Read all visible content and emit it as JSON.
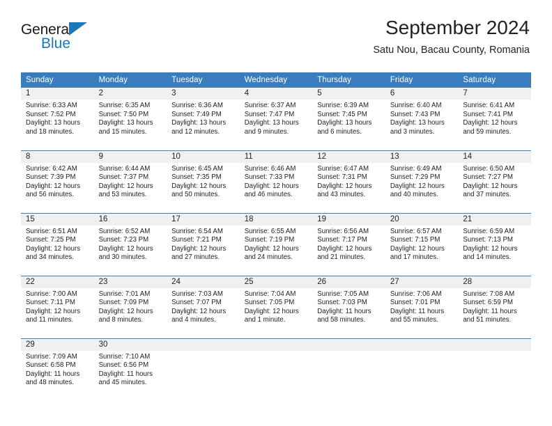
{
  "brand": {
    "name_top": "General",
    "name_bottom": "Blue",
    "triangle_color": "#1878be",
    "text_color": "#1a1a1a"
  },
  "header": {
    "title": "September 2024",
    "subtitle": "Satu Nou, Bacau County, Romania"
  },
  "theme": {
    "header_blue": "#3a7dbf",
    "daynum_band": "#f0f0f0",
    "text": "#222222",
    "separator_blue": "#3a7dbf"
  },
  "columns": [
    "Sunday",
    "Monday",
    "Tuesday",
    "Wednesday",
    "Thursday",
    "Friday",
    "Saturday"
  ],
  "weeks": [
    [
      {
        "day": "1",
        "sunrise": "Sunrise: 6:33 AM",
        "sunset": "Sunset: 7:52 PM",
        "daylight_1": "Daylight: 13 hours",
        "daylight_2": "and 18 minutes."
      },
      {
        "day": "2",
        "sunrise": "Sunrise: 6:35 AM",
        "sunset": "Sunset: 7:50 PM",
        "daylight_1": "Daylight: 13 hours",
        "daylight_2": "and 15 minutes."
      },
      {
        "day": "3",
        "sunrise": "Sunrise: 6:36 AM",
        "sunset": "Sunset: 7:49 PM",
        "daylight_1": "Daylight: 13 hours",
        "daylight_2": "and 12 minutes."
      },
      {
        "day": "4",
        "sunrise": "Sunrise: 6:37 AM",
        "sunset": "Sunset: 7:47 PM",
        "daylight_1": "Daylight: 13 hours",
        "daylight_2": "and 9 minutes."
      },
      {
        "day": "5",
        "sunrise": "Sunrise: 6:39 AM",
        "sunset": "Sunset: 7:45 PM",
        "daylight_1": "Daylight: 13 hours",
        "daylight_2": "and 6 minutes."
      },
      {
        "day": "6",
        "sunrise": "Sunrise: 6:40 AM",
        "sunset": "Sunset: 7:43 PM",
        "daylight_1": "Daylight: 13 hours",
        "daylight_2": "and 3 minutes."
      },
      {
        "day": "7",
        "sunrise": "Sunrise: 6:41 AM",
        "sunset": "Sunset: 7:41 PM",
        "daylight_1": "Daylight: 12 hours",
        "daylight_2": "and 59 minutes."
      }
    ],
    [
      {
        "day": "8",
        "sunrise": "Sunrise: 6:42 AM",
        "sunset": "Sunset: 7:39 PM",
        "daylight_1": "Daylight: 12 hours",
        "daylight_2": "and 56 minutes."
      },
      {
        "day": "9",
        "sunrise": "Sunrise: 6:44 AM",
        "sunset": "Sunset: 7:37 PM",
        "daylight_1": "Daylight: 12 hours",
        "daylight_2": "and 53 minutes."
      },
      {
        "day": "10",
        "sunrise": "Sunrise: 6:45 AM",
        "sunset": "Sunset: 7:35 PM",
        "daylight_1": "Daylight: 12 hours",
        "daylight_2": "and 50 minutes."
      },
      {
        "day": "11",
        "sunrise": "Sunrise: 6:46 AM",
        "sunset": "Sunset: 7:33 PM",
        "daylight_1": "Daylight: 12 hours",
        "daylight_2": "and 46 minutes."
      },
      {
        "day": "12",
        "sunrise": "Sunrise: 6:47 AM",
        "sunset": "Sunset: 7:31 PM",
        "daylight_1": "Daylight: 12 hours",
        "daylight_2": "and 43 minutes."
      },
      {
        "day": "13",
        "sunrise": "Sunrise: 6:49 AM",
        "sunset": "Sunset: 7:29 PM",
        "daylight_1": "Daylight: 12 hours",
        "daylight_2": "and 40 minutes."
      },
      {
        "day": "14",
        "sunrise": "Sunrise: 6:50 AM",
        "sunset": "Sunset: 7:27 PM",
        "daylight_1": "Daylight: 12 hours",
        "daylight_2": "and 37 minutes."
      }
    ],
    [
      {
        "day": "15",
        "sunrise": "Sunrise: 6:51 AM",
        "sunset": "Sunset: 7:25 PM",
        "daylight_1": "Daylight: 12 hours",
        "daylight_2": "and 34 minutes."
      },
      {
        "day": "16",
        "sunrise": "Sunrise: 6:52 AM",
        "sunset": "Sunset: 7:23 PM",
        "daylight_1": "Daylight: 12 hours",
        "daylight_2": "and 30 minutes."
      },
      {
        "day": "17",
        "sunrise": "Sunrise: 6:54 AM",
        "sunset": "Sunset: 7:21 PM",
        "daylight_1": "Daylight: 12 hours",
        "daylight_2": "and 27 minutes."
      },
      {
        "day": "18",
        "sunrise": "Sunrise: 6:55 AM",
        "sunset": "Sunset: 7:19 PM",
        "daylight_1": "Daylight: 12 hours",
        "daylight_2": "and 24 minutes."
      },
      {
        "day": "19",
        "sunrise": "Sunrise: 6:56 AM",
        "sunset": "Sunset: 7:17 PM",
        "daylight_1": "Daylight: 12 hours",
        "daylight_2": "and 21 minutes."
      },
      {
        "day": "20",
        "sunrise": "Sunrise: 6:57 AM",
        "sunset": "Sunset: 7:15 PM",
        "daylight_1": "Daylight: 12 hours",
        "daylight_2": "and 17 minutes."
      },
      {
        "day": "21",
        "sunrise": "Sunrise: 6:59 AM",
        "sunset": "Sunset: 7:13 PM",
        "daylight_1": "Daylight: 12 hours",
        "daylight_2": "and 14 minutes."
      }
    ],
    [
      {
        "day": "22",
        "sunrise": "Sunrise: 7:00 AM",
        "sunset": "Sunset: 7:11 PM",
        "daylight_1": "Daylight: 12 hours",
        "daylight_2": "and 11 minutes."
      },
      {
        "day": "23",
        "sunrise": "Sunrise: 7:01 AM",
        "sunset": "Sunset: 7:09 PM",
        "daylight_1": "Daylight: 12 hours",
        "daylight_2": "and 8 minutes."
      },
      {
        "day": "24",
        "sunrise": "Sunrise: 7:03 AM",
        "sunset": "Sunset: 7:07 PM",
        "daylight_1": "Daylight: 12 hours",
        "daylight_2": "and 4 minutes."
      },
      {
        "day": "25",
        "sunrise": "Sunrise: 7:04 AM",
        "sunset": "Sunset: 7:05 PM",
        "daylight_1": "Daylight: 12 hours",
        "daylight_2": "and 1 minute."
      },
      {
        "day": "26",
        "sunrise": "Sunrise: 7:05 AM",
        "sunset": "Sunset: 7:03 PM",
        "daylight_1": "Daylight: 11 hours",
        "daylight_2": "and 58 minutes."
      },
      {
        "day": "27",
        "sunrise": "Sunrise: 7:06 AM",
        "sunset": "Sunset: 7:01 PM",
        "daylight_1": "Daylight: 11 hours",
        "daylight_2": "and 55 minutes."
      },
      {
        "day": "28",
        "sunrise": "Sunrise: 7:08 AM",
        "sunset": "Sunset: 6:59 PM",
        "daylight_1": "Daylight: 11 hours",
        "daylight_2": "and 51 minutes."
      }
    ],
    [
      {
        "day": "29",
        "sunrise": "Sunrise: 7:09 AM",
        "sunset": "Sunset: 6:58 PM",
        "daylight_1": "Daylight: 11 hours",
        "daylight_2": "and 48 minutes."
      },
      {
        "day": "30",
        "sunrise": "Sunrise: 7:10 AM",
        "sunset": "Sunset: 6:56 PM",
        "daylight_1": "Daylight: 11 hours",
        "daylight_2": "and 45 minutes."
      },
      {
        "day": "",
        "sunrise": "",
        "sunset": "",
        "daylight_1": "",
        "daylight_2": ""
      },
      {
        "day": "",
        "sunrise": "",
        "sunset": "",
        "daylight_1": "",
        "daylight_2": ""
      },
      {
        "day": "",
        "sunrise": "",
        "sunset": "",
        "daylight_1": "",
        "daylight_2": ""
      },
      {
        "day": "",
        "sunrise": "",
        "sunset": "",
        "daylight_1": "",
        "daylight_2": ""
      },
      {
        "day": "",
        "sunrise": "",
        "sunset": "",
        "daylight_1": "",
        "daylight_2": ""
      }
    ]
  ]
}
